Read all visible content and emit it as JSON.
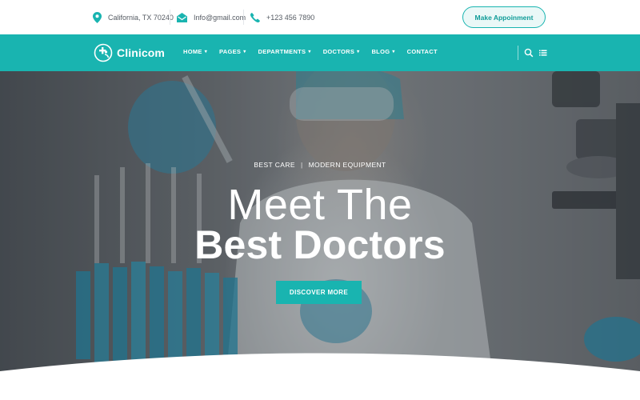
{
  "topbar": {
    "location": "California, TX 70240",
    "email": "Info@gmail.com",
    "phone": "+123 456 7890",
    "appointment_label": "Make Appoinment"
  },
  "brand": {
    "name": "Clinicom",
    "accent": "#19b4b0"
  },
  "nav": {
    "items": [
      {
        "label": "HOME",
        "dropdown": true
      },
      {
        "label": "PAGES",
        "dropdown": true
      },
      {
        "label": "DEPARTMENTS",
        "dropdown": true
      },
      {
        "label": "DOCTORS",
        "dropdown": true
      },
      {
        "label": "BLOG",
        "dropdown": true
      },
      {
        "label": "CONTACT",
        "dropdown": false
      }
    ],
    "icons": [
      "search-icon",
      "menu-icon"
    ]
  },
  "hero": {
    "tag_left": "BEST CARE",
    "tag_sep": "|",
    "tag_right": "MODERN EQUIPMENT",
    "title_line1": "Meet The",
    "title_line2": "Best Doctors",
    "cta_label": "DISCOVER MORE"
  }
}
